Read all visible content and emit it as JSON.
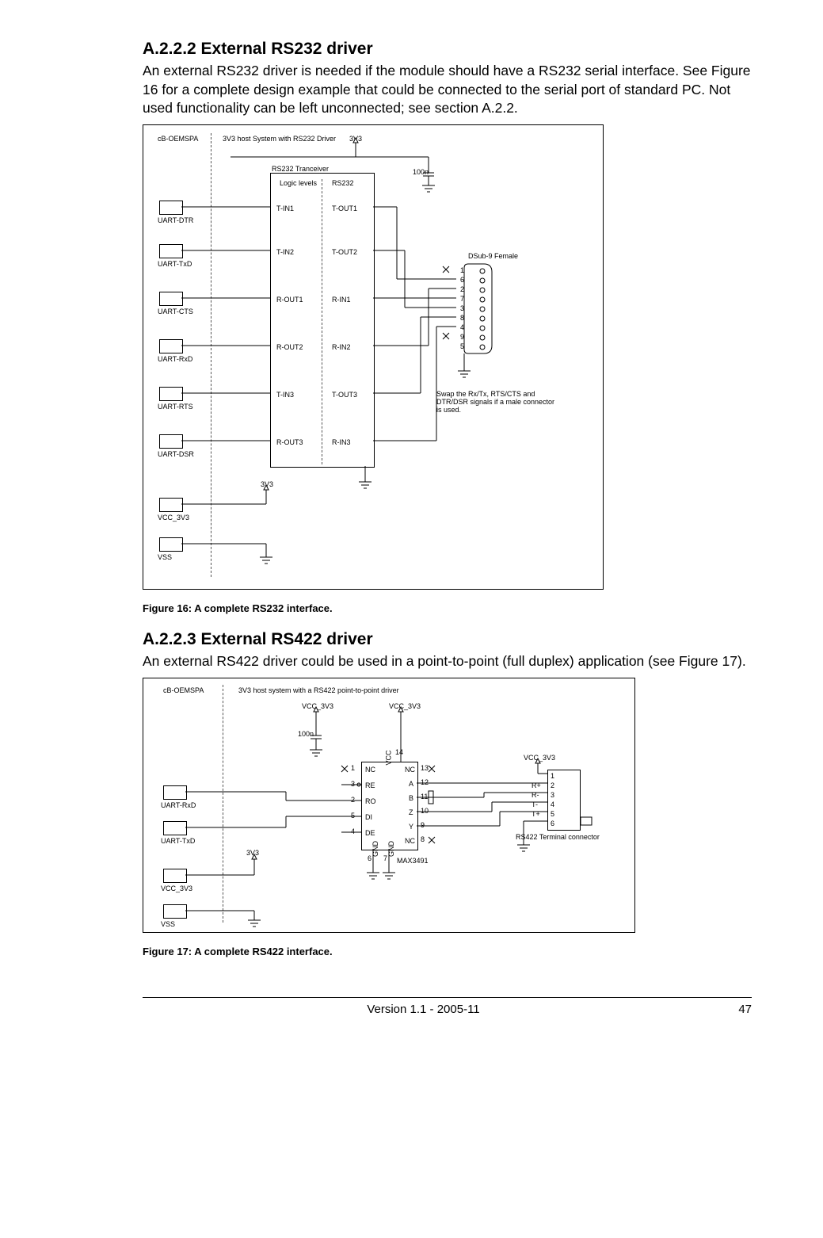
{
  "section1": {
    "heading": "A.2.2.2 External RS232 driver",
    "body": "An external RS232 driver is needed if the module should have a RS232 serial interface. See Figure 16 for a complete design example that could be connected to the serial port of standard PC. Not used functionality can be left unconnected; see section A.2.2.",
    "caption": "Figure 16:  A complete RS232 interface."
  },
  "section2": {
    "heading": "A.2.2.3 External RS422 driver",
    "body": "An external RS422 driver could be used in a point-to-point (full duplex) application (see Figure 17).",
    "caption": "Figure 17:  A complete RS422 interface."
  },
  "footer": {
    "center": "Version 1.1 - 2005-11",
    "right": "47"
  },
  "fig16": {
    "header_left": "cB-OEMSPA",
    "header_mid": "3V3 host System with RS232 Driver",
    "header_right": "3V3",
    "transceiver": "RS232 Tranceiver",
    "logic": "Logic levels",
    "rs232col": "RS232",
    "cap": "100n",
    "connector": "DSub-9 Female",
    "note": "Swap the Rx/Tx, RTS/CTS and DTR/DSR signals if a male connector is used.",
    "pwr": "3V3",
    "pins": [
      "1",
      "6",
      "2",
      "7",
      "3",
      "8",
      "4",
      "9",
      "5"
    ],
    "left_labels": [
      "UART-DTR",
      "UART-TxD",
      "UART-CTS",
      "UART-RxD",
      "UART-RTS",
      "UART-DSR",
      "VCC_3V3",
      "VSS"
    ],
    "chip_left": [
      "T-IN1",
      "T-IN2",
      "R-OUT1",
      "R-OUT2",
      "T-IN3",
      "R-OUT3"
    ],
    "chip_right": [
      "T-OUT1",
      "T-OUT2",
      "R-IN1",
      "R-IN2",
      "T-OUT3",
      "R-IN3"
    ]
  },
  "fig17": {
    "header_left": "cB-OEMSPA",
    "header_mid": "3V3 host system with a RS422 point-to-point driver",
    "vcc": "VCC_3V3",
    "cap": "100n",
    "pwr": "3V3",
    "chip": "MAX3491",
    "conn": "RS422 Terminal connector",
    "left_labels": [
      "UART-RxD",
      "UART-TxD",
      "VCC_3V3",
      "VSS"
    ],
    "chip_pins_left": [
      "NC",
      "RE",
      "RO",
      "DI",
      "DE"
    ],
    "chip_pins_left_nums": [
      "1",
      "3",
      "2",
      "5",
      "4"
    ],
    "chip_pins_right": [
      "NC",
      "A",
      "B",
      "Z",
      "Y",
      "NC"
    ],
    "chip_pins_right_nums": [
      "13",
      "12",
      "11",
      "10",
      "9",
      "8"
    ],
    "chip_top": "VCC",
    "chip_top_num": "14",
    "chip_bot": [
      "GND",
      "GND"
    ],
    "chip_bot_nums": [
      "6",
      "7"
    ],
    "conn_labels": [
      "R+",
      "R-",
      "T-",
      "T+"
    ],
    "conn_nums": [
      "1",
      "2",
      "3",
      "4",
      "5",
      "6"
    ]
  }
}
